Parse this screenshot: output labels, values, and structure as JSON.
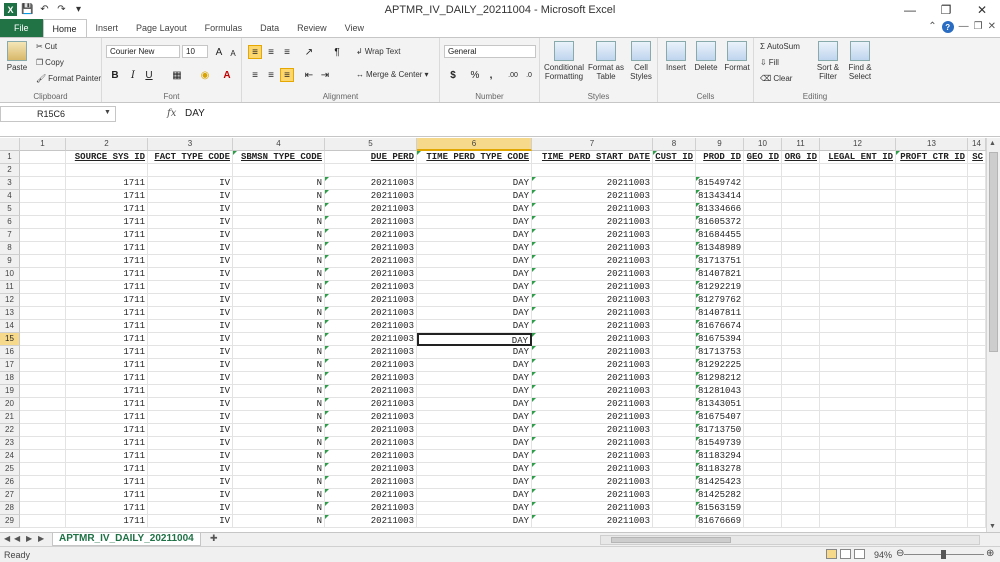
{
  "window": {
    "title": "APTMR_IV_DAILY_20211004  -  Microsoft Excel"
  },
  "tabs": {
    "file": "File",
    "items": [
      "Home",
      "Insert",
      "Page Layout",
      "Formulas",
      "Data",
      "Review",
      "View"
    ],
    "active": "Home"
  },
  "ribbon": {
    "clipboard": {
      "paste": "Paste",
      "cut": "Cut",
      "copy": "Copy",
      "format_painter": "Format Painter",
      "label": "Clipboard"
    },
    "font": {
      "name": "Courier New",
      "size": "10",
      "label": "Font",
      "bold": "B",
      "italic": "I",
      "underline": "U"
    },
    "alignment": {
      "wrap_text": "Wrap Text",
      "merge_center": "Merge & Center",
      "label": "Alignment"
    },
    "number": {
      "format": "General",
      "currency": "$",
      "percent": "%",
      "comma": ",",
      "label": "Number"
    },
    "styles": {
      "conditional": "Conditional Formatting",
      "format_table": "Format as Table",
      "cell_styles": "Cell Styles",
      "label": "Styles"
    },
    "cells": {
      "insert": "Insert",
      "delete": "Delete",
      "format": "Format",
      "label": "Cells"
    },
    "editing": {
      "autosum": "AutoSum",
      "fill": "Fill",
      "clear": "Clear",
      "sort_filter": "Sort & Filter",
      "find_select": "Find & Select",
      "label": "Editing"
    }
  },
  "formula_bar": {
    "name_box": "R15C6",
    "fx": "fx",
    "content": "DAY"
  },
  "grid": {
    "column_numbers": [
      "1",
      "2",
      "3",
      "4",
      "5",
      "6",
      "7",
      "8",
      "9",
      "10",
      "11",
      "12",
      "13",
      "14"
    ],
    "selected_column": "6",
    "headers": [
      "",
      "SOURCE SYS ID",
      "FACT TYPE CODE",
      "SBMSN TYPE CODE",
      "DUE PERD",
      "TIME PERD TYPE CODE",
      "TIME PERD START DATE",
      "CUST ID",
      "PROD ID",
      "GEO ID",
      "ORG ID",
      "LEGAL ENT ID",
      "PROFT CTR ID",
      "SC"
    ],
    "selected_row": "15",
    "rows": [
      {
        "n": "2",
        "cells": [
          "",
          "",
          "",
          "",
          "",
          "",
          "",
          "",
          ""
        ]
      },
      {
        "n": "3",
        "cells": [
          "1711",
          "IV",
          "N",
          "20211003",
          "DAY",
          "20211003",
          "",
          "81549742"
        ]
      },
      {
        "n": "4",
        "cells": [
          "1711",
          "IV",
          "N",
          "20211003",
          "DAY",
          "20211003",
          "",
          "81343414"
        ]
      },
      {
        "n": "5",
        "cells": [
          "1711",
          "IV",
          "N",
          "20211003",
          "DAY",
          "20211003",
          "",
          "81334666"
        ]
      },
      {
        "n": "6",
        "cells": [
          "1711",
          "IV",
          "N",
          "20211003",
          "DAY",
          "20211003",
          "",
          "81605372"
        ]
      },
      {
        "n": "7",
        "cells": [
          "1711",
          "IV",
          "N",
          "20211003",
          "DAY",
          "20211003",
          "",
          "81684455"
        ]
      },
      {
        "n": "8",
        "cells": [
          "1711",
          "IV",
          "N",
          "20211003",
          "DAY",
          "20211003",
          "",
          "81348989"
        ]
      },
      {
        "n": "9",
        "cells": [
          "1711",
          "IV",
          "N",
          "20211003",
          "DAY",
          "20211003",
          "",
          "81713751"
        ]
      },
      {
        "n": "10",
        "cells": [
          "1711",
          "IV",
          "N",
          "20211003",
          "DAY",
          "20211003",
          "",
          "81407821"
        ]
      },
      {
        "n": "11",
        "cells": [
          "1711",
          "IV",
          "N",
          "20211003",
          "DAY",
          "20211003",
          "",
          "81292219"
        ]
      },
      {
        "n": "12",
        "cells": [
          "1711",
          "IV",
          "N",
          "20211003",
          "DAY",
          "20211003",
          "",
          "81279762"
        ]
      },
      {
        "n": "13",
        "cells": [
          "1711",
          "IV",
          "N",
          "20211003",
          "DAY",
          "20211003",
          "",
          "81407811"
        ]
      },
      {
        "n": "14",
        "cells": [
          "1711",
          "IV",
          "N",
          "20211003",
          "DAY",
          "20211003",
          "",
          "81676674"
        ]
      },
      {
        "n": "15",
        "cells": [
          "1711",
          "IV",
          "N",
          "20211003",
          "DAY",
          "20211003",
          "",
          "81675394"
        ]
      },
      {
        "n": "16",
        "cells": [
          "1711",
          "IV",
          "N",
          "20211003",
          "DAY",
          "20211003",
          "",
          "81713753"
        ]
      },
      {
        "n": "17",
        "cells": [
          "1711",
          "IV",
          "N",
          "20211003",
          "DAY",
          "20211003",
          "",
          "81292225"
        ]
      },
      {
        "n": "18",
        "cells": [
          "1711",
          "IV",
          "N",
          "20211003",
          "DAY",
          "20211003",
          "",
          "81298212"
        ]
      },
      {
        "n": "19",
        "cells": [
          "1711",
          "IV",
          "N",
          "20211003",
          "DAY",
          "20211003",
          "",
          "81281043"
        ]
      },
      {
        "n": "20",
        "cells": [
          "1711",
          "IV",
          "N",
          "20211003",
          "DAY",
          "20211003",
          "",
          "81343051"
        ]
      },
      {
        "n": "21",
        "cells": [
          "1711",
          "IV",
          "N",
          "20211003",
          "DAY",
          "20211003",
          "",
          "81675407"
        ]
      },
      {
        "n": "22",
        "cells": [
          "1711",
          "IV",
          "N",
          "20211003",
          "DAY",
          "20211003",
          "",
          "81713750"
        ]
      },
      {
        "n": "23",
        "cells": [
          "1711",
          "IV",
          "N",
          "20211003",
          "DAY",
          "20211003",
          "",
          "81549739"
        ]
      },
      {
        "n": "24",
        "cells": [
          "1711",
          "IV",
          "N",
          "20211003",
          "DAY",
          "20211003",
          "",
          "81183294"
        ]
      },
      {
        "n": "25",
        "cells": [
          "1711",
          "IV",
          "N",
          "20211003",
          "DAY",
          "20211003",
          "",
          "81183278"
        ]
      },
      {
        "n": "26",
        "cells": [
          "1711",
          "IV",
          "N",
          "20211003",
          "DAY",
          "20211003",
          "",
          "81425423"
        ]
      },
      {
        "n": "27",
        "cells": [
          "1711",
          "IV",
          "N",
          "20211003",
          "DAY",
          "20211003",
          "",
          "81425282"
        ]
      },
      {
        "n": "28",
        "cells": [
          "1711",
          "IV",
          "N",
          "20211003",
          "DAY",
          "20211003",
          "",
          "81563159"
        ]
      },
      {
        "n": "29",
        "cells": [
          "1711",
          "IV",
          "N",
          "20211003",
          "DAY",
          "20211003",
          "",
          "81676669"
        ]
      }
    ]
  },
  "sheet_tabs": {
    "active": "APTMR_IV_DAILY_20211004"
  },
  "status_bar": {
    "status": "Ready",
    "zoom": "94%"
  },
  "colors": {
    "file_tab": "#217346",
    "selection_header": "#f7d98b",
    "error_triangle": "#2e9d4a"
  }
}
